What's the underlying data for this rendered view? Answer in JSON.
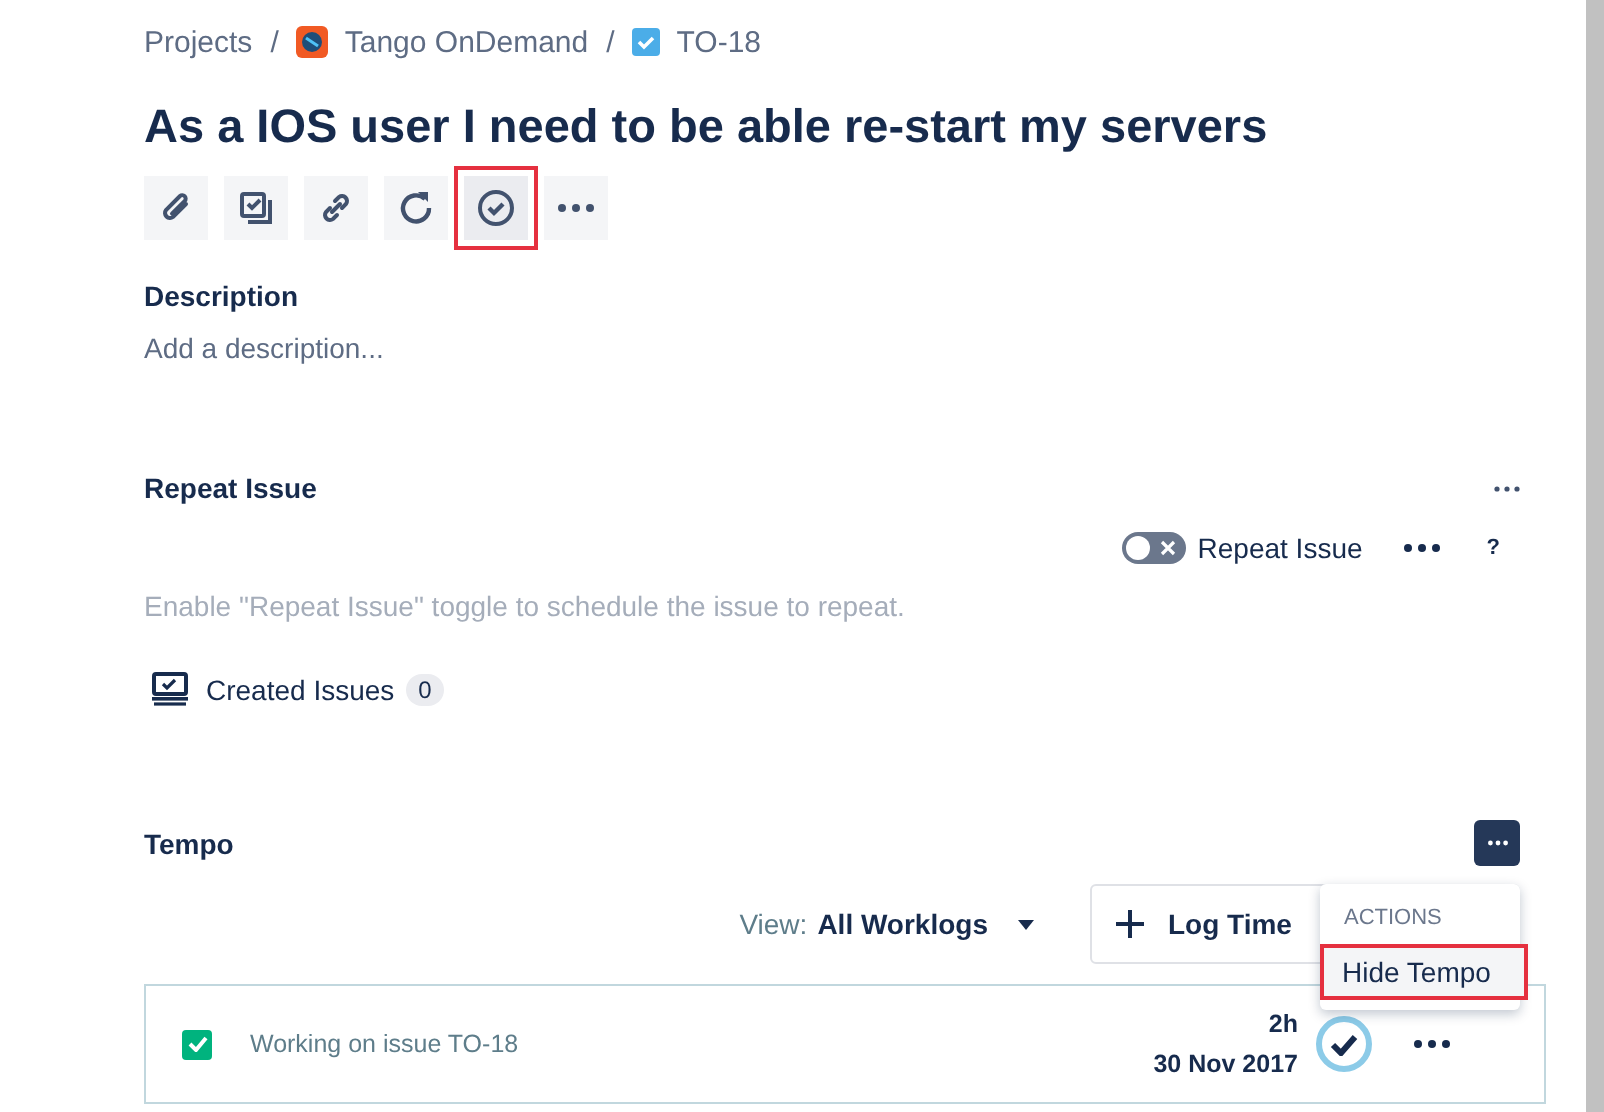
{
  "breadcrumb_separator": "/",
  "breadcrumbs": [
    {
      "kind": "text",
      "label": "Projects"
    },
    {
      "kind": "project",
      "label": "Tango OnDemand"
    },
    {
      "kind": "issue",
      "label": "TO-18"
    }
  ],
  "title": "As a IOS user I need to be able re-start my servers",
  "toolbar": [
    {
      "kind": "attach",
      "highlighted": false
    },
    {
      "kind": "subtask",
      "highlighted": false
    },
    {
      "kind": "link",
      "highlighted": false
    },
    {
      "kind": "repeat",
      "highlighted": false
    },
    {
      "kind": "check",
      "highlighted": true
    },
    {
      "kind": "more",
      "highlighted": false
    }
  ],
  "description": {
    "label": "Description",
    "placeholder": "Add a description..."
  },
  "repeat_issue": {
    "heading": "Repeat Issue",
    "toggle_label": "Repeat Issue",
    "toggle_on": false,
    "help": "?",
    "hint": "Enable \"Repeat Issue\" toggle to schedule the issue to repeat.",
    "created_issues": {
      "label": "Created Issues",
      "count": "0"
    }
  },
  "tempo": {
    "heading": "Tempo",
    "menu_open": true,
    "view_label": "View:",
    "view_value": "All Worklogs",
    "log_time": "Log Time",
    "menu": {
      "heading": "ACTIONS",
      "items": [
        {
          "label": "Hide Tempo",
          "highlighted": true
        }
      ]
    },
    "worklogs": [
      {
        "checked": true,
        "description": "Working on issue TO-18",
        "duration": "2h",
        "date": "30 Nov 2017",
        "approved": true
      }
    ]
  }
}
